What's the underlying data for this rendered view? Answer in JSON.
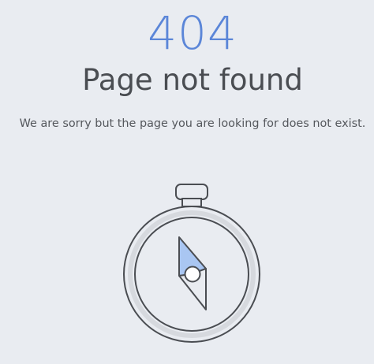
{
  "error": {
    "code": "404",
    "title": "Page not found",
    "message": "We are sorry but the page you are looking for does not exist."
  },
  "colors": {
    "background": "#e9ecf1",
    "accent": "#5b86d8",
    "text": "#4a4d52",
    "compass_needle": "#a9c6f2"
  },
  "illustration": {
    "icon": "compass-icon"
  }
}
